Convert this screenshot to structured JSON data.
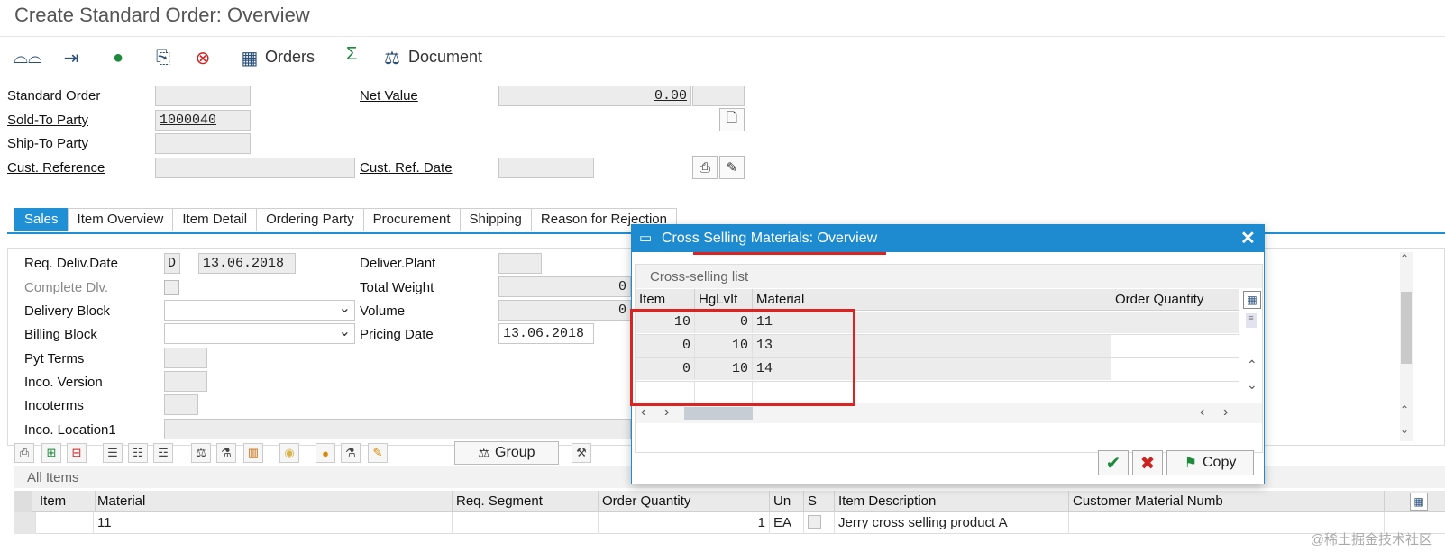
{
  "window_title": "Create Standard Order: Overview",
  "toolbar": {
    "orders_label": "Orders",
    "document_label": "Document",
    "sum_symbol": "Σ"
  },
  "header": {
    "standard_order_label": "Standard Order",
    "standard_order_value": "",
    "net_value_label": "Net Value",
    "net_value": "0.00",
    "sold_to_label": "Sold-To Party",
    "sold_to_value": "1000040",
    "ship_to_label": "Ship-To Party",
    "ship_to_value": "",
    "cust_ref_label": "Cust. Reference",
    "cust_ref_value": "",
    "cust_ref_date_label": "Cust. Ref. Date",
    "cust_ref_date_value": ""
  },
  "tabs": [
    "Sales",
    "Item Overview",
    "Item Detail",
    "Ordering Party",
    "Procurement",
    "Shipping",
    "Reason for Rejection"
  ],
  "sales": {
    "req_deliv_label": "Req. Deliv.Date",
    "req_deliv_fmt": "D",
    "req_deliv_value": "13.06.2018",
    "complete_dlv_label": "Complete Dlv.",
    "delivery_block_label": "Delivery Block",
    "billing_block_label": "Billing Block",
    "pyt_terms_label": "Pyt Terms",
    "inco_version_label": "Inco. Version",
    "incoterms_label": "Incoterms",
    "inco_location_label": "Inco. Location1",
    "deliver_plant_label": "Deliver.Plant",
    "total_weight_label": "Total Weight",
    "total_weight_value": "0",
    "volume_label": "Volume",
    "volume_value": "0",
    "pricing_date_label": "Pricing Date",
    "pricing_date_value": "13.06.2018"
  },
  "items_toolbar": {
    "group_label": "Group"
  },
  "all_items": {
    "title": "All Items",
    "columns": [
      "Item",
      "Material",
      "Req. Segment",
      "Order Quantity",
      "Un",
      "S",
      "Item Description",
      "Customer Material Numb"
    ],
    "rows": [
      {
        "item": "",
        "material": "11",
        "req_segment": "",
        "order_qty": "1",
        "unit": "EA",
        "desc": "Jerry cross selling product A",
        "cust_mat": ""
      }
    ]
  },
  "popup": {
    "title": "Cross Selling Materials: Overview",
    "list_title": "Cross-selling list",
    "columns": [
      "Item",
      "HgLvIt",
      "Material",
      "Order Quantity"
    ],
    "rows": [
      {
        "item": "10",
        "hglvit": "0",
        "material": "11",
        "qty": ""
      },
      {
        "item": "0",
        "hglvit": "10",
        "material": "13",
        "qty": ""
      },
      {
        "item": "0",
        "hglvit": "10",
        "material": "14",
        "qty": ""
      }
    ],
    "copy_label": "Copy"
  },
  "watermark": "@稀土掘金技术社区",
  "colors": {
    "accent": "#1e8bd0",
    "highlight": "#dd2222"
  }
}
